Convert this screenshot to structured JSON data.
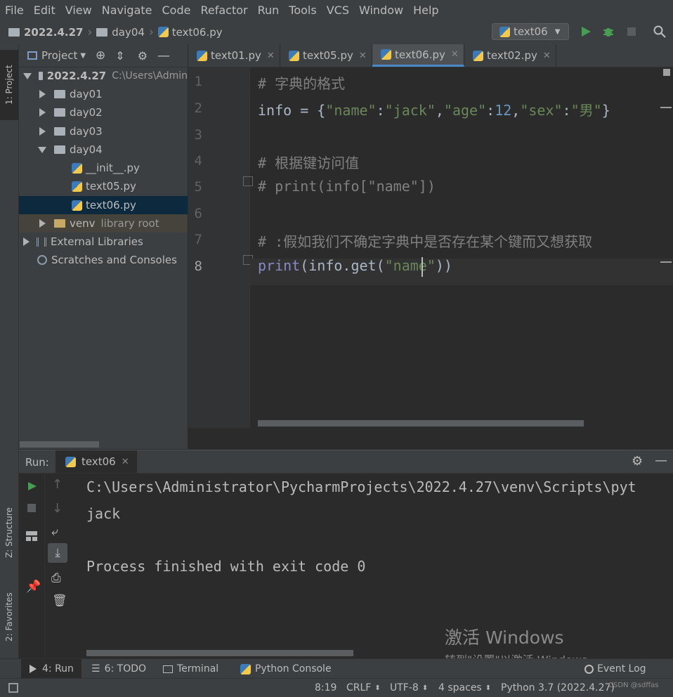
{
  "menu": [
    "File",
    "Edit",
    "View",
    "Navigate",
    "Code",
    "Refactor",
    "Run",
    "Tools",
    "VCS",
    "Window",
    "Help"
  ],
  "breadcrumb": {
    "project": "2022.4.27",
    "folder": "day04",
    "file": "text06.py"
  },
  "run_config": "text06",
  "left_strip": {
    "project": "1: Project",
    "structure": "Z: Structure",
    "favorites": "2: Favorites"
  },
  "project_panel": {
    "title": "Project",
    "root_name": "2022.4.27",
    "root_path": "C:\\Users\\Admin",
    "items": [
      {
        "label": "day01"
      },
      {
        "label": "day02"
      },
      {
        "label": "day03"
      },
      {
        "label": "day04"
      },
      {
        "label": "__init__.py"
      },
      {
        "label": "text05.py"
      },
      {
        "label": "text06.py"
      },
      {
        "label": "venv",
        "suffix": "library root"
      },
      {
        "label": "External Libraries"
      },
      {
        "label": "Scratches and Consoles"
      }
    ]
  },
  "editor_tabs": [
    "text01.py",
    "text05.py",
    "text06.py",
    "text02.py"
  ],
  "code": {
    "line_numbers": [
      "1",
      "2",
      "3",
      "4",
      "5",
      "6",
      "7",
      "8"
    ],
    "l1": "# 字典的格式",
    "l2_a": "info = {",
    "l2_s1": "\"name\"",
    "l2_s2": "\"jack\"",
    "l2_s3": "\"age\"",
    "l2_n": "12",
    "l2_s4": "\"sex\"",
    "l2_s5": "\"男\"",
    "l2_end": "}",
    "l4": "# 根据键访问值",
    "l5": "# print(info[\"name\"])",
    "l7": "# :假如我们不确定字典中是否存在某个键而又想获取",
    "l8_fn": "print",
    "l8_a": "(info.get(",
    "l8_s": "\"name\"",
    "l8_end": "))"
  },
  "run": {
    "label": "Run:",
    "tab": "text06",
    "output": [
      "C:\\Users\\Administrator\\PycharmProjects\\2022.4.27\\venv\\Scripts\\pyt",
      "jack",
      "",
      "Process finished with exit code 0"
    ]
  },
  "bottom_tabs": [
    "4: Run",
    "6: TODO",
    "Terminal",
    "Python Console"
  ],
  "event_log": "Event Log",
  "watermark": {
    "line1": "激活 Windows",
    "line2": "转到\"设置\"以激活 Windows。"
  },
  "status": {
    "position": "8:19",
    "line_sep": "CRLF",
    "encoding": "UTF-8",
    "indent": "4 spaces",
    "interpreter": "Python 3.7 (2022.4.27)",
    "credit": "CSDN @sdffas"
  },
  "colors": {
    "accent": "#4a88c7",
    "run_green": "#499c54",
    "selected": "#0d293e"
  }
}
